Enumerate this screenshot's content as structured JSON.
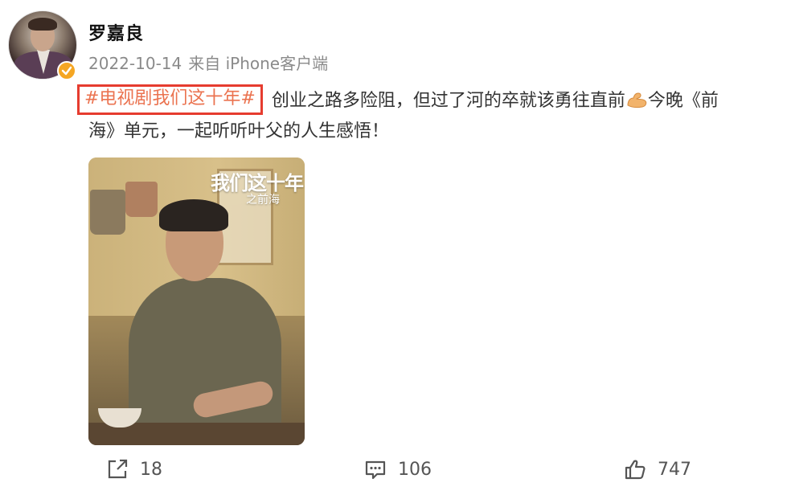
{
  "user": {
    "name": "罗嘉良",
    "verified": true,
    "verified_color": "#f5a623"
  },
  "meta": {
    "date": "2022-10-14",
    "source": "来自 iPhone客户端"
  },
  "post": {
    "hashtag": "#电视剧我们这十年#",
    "text_line1_after": " 创业之路多险阻，但过了河的卒就该勇往直前",
    "emoji": "muscle-emoji",
    "text_line1_end": "今晚《前",
    "text_line2": "海》单元，一起听听叶父的人生感悟！",
    "hashtag_color": "#eb7350",
    "highlight_color": "#e63c2f"
  },
  "image": {
    "title_text": "我们这十年",
    "subtitle_text": "之前海"
  },
  "actions": {
    "share_count": "18",
    "comment_count": "106",
    "like_count": "747"
  }
}
